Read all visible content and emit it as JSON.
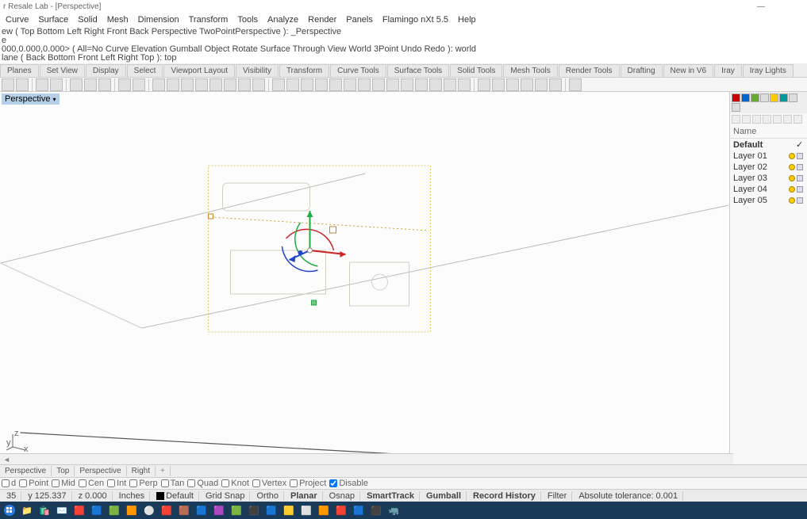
{
  "title": "r Resale Lab - [Perspective]",
  "window_buttons": {
    "min": "—",
    "max": "",
    "close": ""
  },
  "menus": [
    "Curve",
    "Surface",
    "Solid",
    "Mesh",
    "Dimension",
    "Transform",
    "Tools",
    "Analyze",
    "Render",
    "Panels",
    "Flamingo nXt 5.5",
    "Help"
  ],
  "command_history": [
    "ew ( Top  Bottom  Left  Right  Front  Back  Perspective  TwoPointPerspective ): _Perspective",
    "e",
    "000,0.000,0.000> ( All=No  Curve  Elevation  Gumball  Object  Rotate  Surface  Through  View  World  3Point  Undo  Redo ): world",
    "lane ( Back  Bottom  Front  Left  Right  Top ): top"
  ],
  "tool_tabs": [
    "Planes",
    "Set View",
    "Display",
    "Select",
    "Viewport Layout",
    "Visibility",
    "Transform",
    "Curve Tools",
    "Surface Tools",
    "Solid Tools",
    "Mesh Tools",
    "Render Tools",
    "Drafting",
    "New in V6",
    "Iray",
    "Iray Lights"
  ],
  "viewport_label": "Perspective",
  "axes_labels": {
    "x": "x",
    "y": "y",
    "z": "z"
  },
  "layers_panel": {
    "header": "Name",
    "rows": [
      {
        "name": "Default",
        "current": true
      },
      {
        "name": "Layer 01",
        "current": false
      },
      {
        "name": "Layer 02",
        "current": false
      },
      {
        "name": "Layer 03",
        "current": false
      },
      {
        "name": "Layer 04",
        "current": false
      },
      {
        "name": "Layer 05",
        "current": false
      }
    ]
  },
  "bottom_tabs": [
    "Perspective",
    "Top",
    "Perspective",
    "Right"
  ],
  "bottom_tabs_plus": "+",
  "osnaps": [
    {
      "label": "d",
      "checked": false
    },
    {
      "label": "Point",
      "checked": false
    },
    {
      "label": "Mid",
      "checked": false
    },
    {
      "label": "Cen",
      "checked": false
    },
    {
      "label": "Int",
      "checked": false
    },
    {
      "label": "Perp",
      "checked": false
    },
    {
      "label": "Tan",
      "checked": false
    },
    {
      "label": "Quad",
      "checked": false
    },
    {
      "label": "Knot",
      "checked": false
    },
    {
      "label": "Vertex",
      "checked": false
    },
    {
      "label": "Project",
      "checked": false
    },
    {
      "label": "Disable",
      "checked": true
    }
  ],
  "status": {
    "x": "35",
    "y": "y 125.337",
    "z": "z 0.000",
    "units": "Inches",
    "layer": "Default",
    "gridsnap": "Grid Snap",
    "ortho": "Ortho",
    "planar": "Planar",
    "osnap": "Osnap",
    "smarttrack": "SmartTrack",
    "gumball": "Gumball",
    "recordhistory": "Record History",
    "filter": "Filter",
    "tolerance": "Absolute tolerance: 0.001"
  }
}
